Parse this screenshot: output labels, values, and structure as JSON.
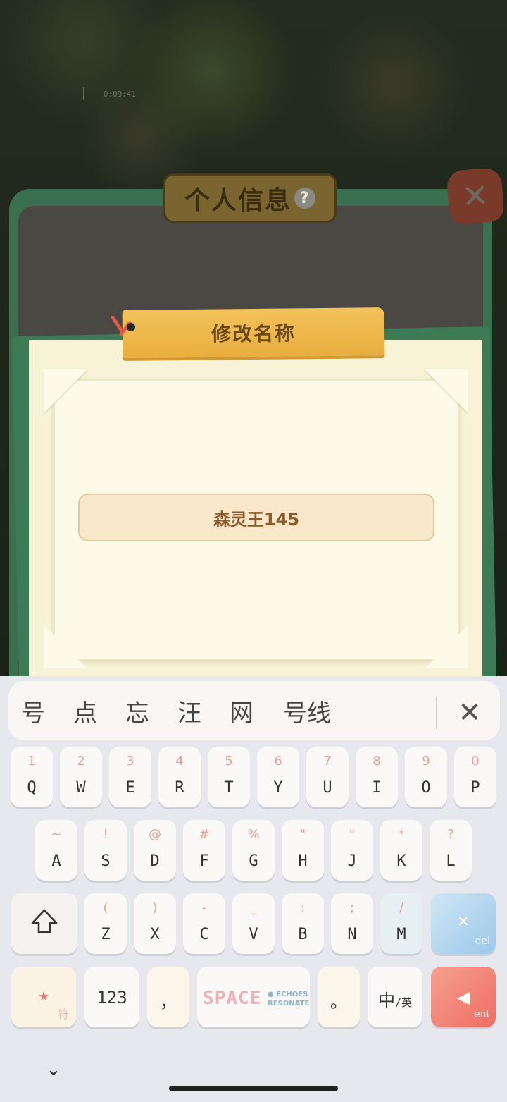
{
  "game": {
    "timer": "0:09:41",
    "panel_title": "个人信息",
    "help_icon": "?",
    "close_icon": "✕"
  },
  "rename_dialog": {
    "title": "修改名称",
    "name_value": "森灵王145"
  },
  "keyboard": {
    "candidates": [
      "号",
      "点",
      "忘",
      "汪",
      "网",
      "号线"
    ],
    "close_icon": "✕",
    "rows": [
      [
        {
          "hint": "1",
          "key": "Q"
        },
        {
          "hint": "2",
          "key": "W"
        },
        {
          "hint": "3",
          "key": "E"
        },
        {
          "hint": "4",
          "key": "R"
        },
        {
          "hint": "5",
          "key": "T"
        },
        {
          "hint": "6",
          "key": "Y"
        },
        {
          "hint": "7",
          "key": "U"
        },
        {
          "hint": "8",
          "key": "I"
        },
        {
          "hint": "9",
          "key": "O"
        },
        {
          "hint": "0",
          "key": "P"
        }
      ],
      [
        {
          "hint": "~",
          "key": "A"
        },
        {
          "hint": "!",
          "key": "S"
        },
        {
          "hint": "@",
          "key": "D"
        },
        {
          "hint": "#",
          "key": "F"
        },
        {
          "hint": "%",
          "key": "G"
        },
        {
          "hint": "\"",
          "key": "H"
        },
        {
          "hint": "\"",
          "key": "J"
        },
        {
          "hint": "*",
          "key": "K"
        },
        {
          "hint": "?",
          "key": "L"
        }
      ],
      [
        {
          "hint": "(",
          "key": "Z"
        },
        {
          "hint": ")",
          "key": "X"
        },
        {
          "hint": "-",
          "key": "C"
        },
        {
          "hint": "_",
          "key": "V"
        },
        {
          "hint": ":",
          "key": "B"
        },
        {
          "hint": ";",
          "key": "N"
        },
        {
          "hint": "/",
          "key": "M"
        }
      ]
    ],
    "shift_icon": "⇧",
    "delete_icon": "✕",
    "delete_label": "del",
    "symbol_label": "符",
    "numeric_label": "123",
    "comma_label": "，",
    "space_label": "SPACE",
    "space_brand_1": "● ECHOES",
    "space_brand_2": "RESONATE",
    "period_label": "。",
    "lang_main": "中",
    "lang_sub": "/英",
    "enter_label": "ent",
    "collapse_icon": "⌄"
  }
}
